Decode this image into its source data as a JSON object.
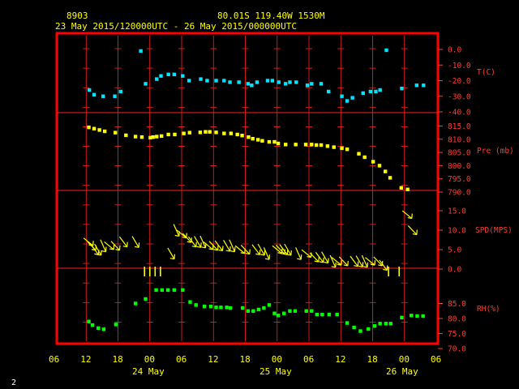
{
  "header": {
    "station_id": "8903",
    "location": "80.01S  119.40W  1530M",
    "period": "23 May 2015/120000UTC - 26 May 2015/000000UTC"
  },
  "footer": {
    "page_number": "2",
    "hour_ticks": [
      "06",
      "12",
      "18",
      "00",
      "06",
      "12",
      "18",
      "00",
      "06",
      "12",
      "18",
      "00",
      "06"
    ],
    "date_labels": [
      "24 May",
      "25 May",
      "26 May"
    ]
  },
  "colors": {
    "frame": "#ff0000",
    "axis_text": "#ff3b2f",
    "grid": "#ff2020",
    "temperature": "#00e5ff",
    "pressure": "#ffff00",
    "wind": "#ffff00",
    "humidity": "#00ff00",
    "header_text": "#ffff00"
  },
  "chart_data": [
    {
      "type": "scatter",
      "panel": "temperature",
      "ylabel": "T(C)",
      "yticks": [
        "0.0",
        "-10.0",
        "-20.0",
        "-30.0",
        "-40.0"
      ],
      "ylim": [
        -40,
        0
      ],
      "x_unit": "hours since 23 May 2015 00UTC",
      "x": [
        12.6,
        13.5,
        15.2,
        17.4,
        18.5,
        22.3,
        23.2,
        25.3,
        26.1,
        27.5,
        28.6,
        30.2,
        31.4,
        33.6,
        34.8,
        36.5,
        38.0,
        39.1,
        40.8,
        42.5,
        43.2,
        44.2,
        46.2,
        47.1,
        48.3,
        49.6,
        50.4,
        51.6,
        53.7,
        54.5,
        56.3,
        57.7,
        60.2,
        61.2,
        62.2,
        64.2,
        65.6,
        66.6,
        67.4,
        68.6,
        71.5,
        74.3,
        75.6
      ],
      "y": [
        -26,
        -29,
        -30,
        -30,
        -27,
        -1,
        -22,
        -19,
        -17,
        -16,
        -16,
        -17,
        -20,
        -19,
        -20,
        -20,
        -20,
        -21,
        -21,
        -22,
        -23,
        -21,
        -20,
        -20,
        -21,
        -22,
        -21,
        -21,
        -23,
        -22,
        -22,
        -27,
        -30,
        -33,
        -31,
        -28,
        -27,
        -27,
        -26,
        -0.5,
        -25,
        -23,
        -23
      ]
    },
    {
      "type": "scatter",
      "panel": "pressure",
      "ylabel": "Pre (mb)",
      "yticks": [
        "815.0",
        "810.0",
        "805.0",
        "800.0",
        "795.0",
        "790.0"
      ],
      "ylim": [
        790,
        817
      ],
      "x_unit": "hours since 23 May 2015 00UTC",
      "x": [
        12.5,
        13.5,
        14.5,
        15.5,
        17.5,
        19.5,
        21.3,
        22.5,
        24.1,
        24.6,
        25.3,
        26.2,
        27.5,
        28.7,
        30.4,
        31.5,
        33.5,
        34.5,
        35.3,
        36.5,
        38.0,
        39.3,
        40.5,
        41.4,
        42.6,
        43.4,
        44.4,
        45.2,
        46.5,
        47.5,
        48.2,
        49.6,
        51.5,
        53.4,
        54.5,
        55.4,
        56.3,
        57.5,
        58.7,
        60.2,
        61.2,
        63.4,
        64.5,
        66.1,
        67.3,
        68.4,
        69.3,
        71.4,
        72.6
      ],
      "y": [
        814.5,
        814,
        813.5,
        813,
        812.5,
        811.5,
        811,
        810.8,
        810.6,
        810.8,
        811,
        811.2,
        811.8,
        811.8,
        812.2,
        812.5,
        812.6,
        812.8,
        812.8,
        812.6,
        812.2,
        812.2,
        811.8,
        811.4,
        810.8,
        810.2,
        809.8,
        809.4,
        809,
        809,
        808.4,
        808,
        808,
        808,
        808,
        807.8,
        807.8,
        807.4,
        807,
        806.6,
        806.2,
        804.5,
        803.2,
        801.5,
        800,
        797.8,
        795.4,
        791.6,
        791
      ]
    },
    {
      "type": "scatter",
      "panel": "wind_speed",
      "ylabel": "SPD(MPS)",
      "yticks": [
        "15.0",
        "10.0",
        "5.0",
        "0.0"
      ],
      "ylim": [
        0,
        15
      ],
      "x_unit": "hours since 23 May 2015 00UTC",
      "x": [
        12.4,
        13.0,
        13.6,
        14.2,
        15.2,
        16.3,
        17.5,
        19.0,
        21.3,
        23.0,
        24.0,
        25.0,
        26.0,
        28.0,
        29.0,
        30.0,
        31.0,
        32.0,
        33.0,
        34.0,
        35.0,
        36.0,
        37.0,
        38.5,
        39.5,
        41.0,
        42.0,
        44.0,
        45.0,
        46.0,
        48.0,
        48.6,
        49.2,
        50.0,
        52.0,
        53.5,
        55.0,
        56.0,
        57.0,
        58.5,
        59.2,
        60.5,
        62.5,
        63.5,
        64.5,
        65.5,
        67.0,
        68.0,
        69.0,
        71.0,
        72.5,
        73.5
      ],
      "y": [
        7,
        6,
        5,
        5,
        6,
        6,
        6,
        7,
        7,
        0,
        0,
        0,
        0,
        4,
        10,
        9,
        8,
        7,
        7,
        7,
        6,
        6,
        6,
        6,
        6,
        5,
        5,
        5,
        5,
        4,
        5,
        5,
        5,
        5,
        4,
        4,
        3,
        3,
        3,
        2,
        2,
        2,
        2,
        2,
        2,
        2,
        2,
        1,
        0,
        0,
        14,
        10
      ]
    },
    {
      "type": "scatter",
      "panel": "relative_humidity",
      "ylabel": "RH(%)",
      "yticks": [
        "85.0",
        "80.0",
        "75.0",
        "70.0"
      ],
      "ylim": [
        70,
        90
      ],
      "x_unit": "hours since 23 May 2015 00UTC",
      "x": [
        12.5,
        13.2,
        14.3,
        15.3,
        17.6,
        21.3,
        23.2,
        25.2,
        26.3,
        27.4,
        28.6,
        30.2,
        31.6,
        32.7,
        34.3,
        35.5,
        36.5,
        37.4,
        38.5,
        39.2,
        41.5,
        42.5,
        43.5,
        44.5,
        45.5,
        46.5,
        47.5,
        48.2,
        49.3,
        50.4,
        51.4,
        53.5,
        54.5,
        55.5,
        56.5,
        57.8,
        59.3,
        61.2,
        62.5,
        63.7,
        65.2,
        66.4,
        67.4,
        68.5,
        69.4,
        71.5,
        73.3,
        74.4,
        75.5
      ],
      "y": [
        79,
        77.8,
        76.8,
        76.4,
        78,
        85,
        86.5,
        89.5,
        89.5,
        89.5,
        89.5,
        89.5,
        85.5,
        84.5,
        84,
        84,
        83.7,
        83.7,
        83.7,
        83.5,
        83.5,
        82.5,
        82.5,
        83,
        83.5,
        84.5,
        81.7,
        81,
        81.7,
        82.5,
        82.5,
        82.5,
        82.5,
        81.3,
        81.3,
        81.3,
        81.3,
        78.5,
        77,
        75.8,
        76.5,
        77.5,
        78.3,
        78.3,
        78.3,
        80.3,
        81,
        80.8,
        80.8
      ]
    }
  ]
}
